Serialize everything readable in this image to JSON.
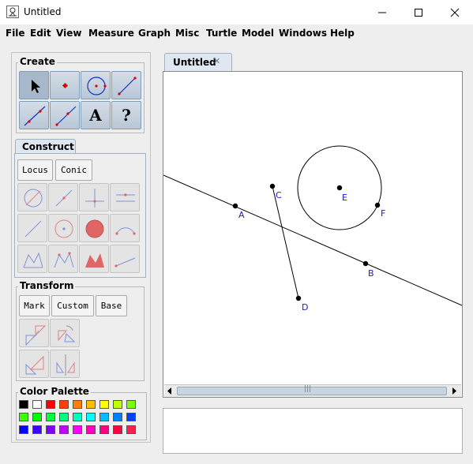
{
  "window": {
    "title": "Untitled"
  },
  "menu": [
    "File",
    "Edit",
    "View",
    "Measure",
    "Graph",
    "Misc",
    "Turtle",
    "Model",
    "Windows",
    "Help"
  ],
  "create": {
    "title": "Create",
    "tools": [
      "select-arrow",
      "point",
      "circle",
      "segment",
      "line",
      "ray",
      "text",
      "help"
    ],
    "text_glyph": "A",
    "help_glyph": "?"
  },
  "construct": {
    "tab": "Construct",
    "locus": "Locus",
    "conic": "Conic"
  },
  "transform": {
    "title": "Transform",
    "mark": "Mark",
    "custom": "Custom",
    "base": "Base"
  },
  "palette": {
    "title": "Color Palette",
    "colors": [
      "#000000",
      "#ffffff",
      "#ff0000",
      "#ff4000",
      "#ff8000",
      "#ffbf00",
      "#ffff00",
      "#bfff00",
      "#80ff00",
      "#40ff00",
      "#00ff00",
      "#00ff40",
      "#00ff80",
      "#00ffbf",
      "#00ffff",
      "#00bfff",
      "#0080ff",
      "#0040ff",
      "#0000ff",
      "#4000ff",
      "#8000ff",
      "#bf00ff",
      "#ff00ff",
      "#ff00bf",
      "#ff0080",
      "#ff0040",
      "#ff2050"
    ]
  },
  "document": {
    "tab_label": "Untitled",
    "close_glyph": "✕"
  },
  "canvas": {
    "points": [
      {
        "label": "A"
      },
      {
        "label": "B"
      },
      {
        "label": "C"
      },
      {
        "label": "D"
      },
      {
        "label": "E"
      },
      {
        "label": "F"
      }
    ]
  },
  "scrollbar": {
    "grip": "|||"
  }
}
